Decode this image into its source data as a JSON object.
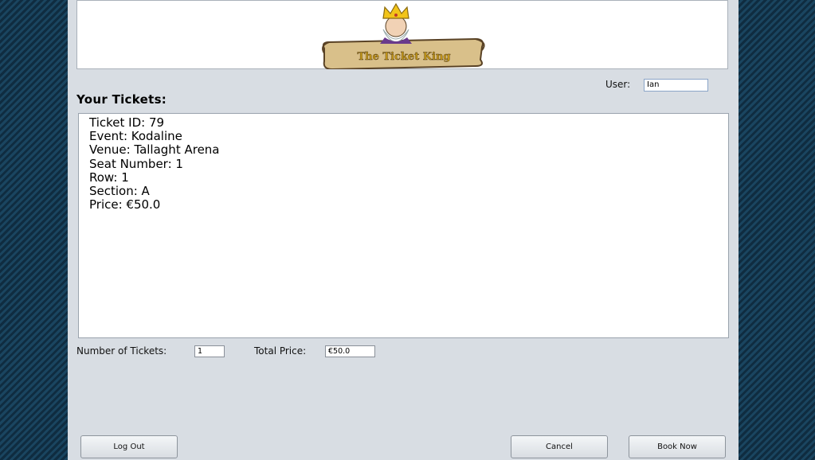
{
  "header": {
    "logo_text": "The Ticket King"
  },
  "user": {
    "label": "User:",
    "value": "Ian"
  },
  "tickets": {
    "title": "Your Tickets:",
    "lines": [
      "Ticket ID: 79",
      "Event: Kodaline",
      "Venue: Tallaght Arena",
      "Seat Number: 1",
      "Row: 1",
      "Section: A",
      "Price: €50.0"
    ]
  },
  "summary": {
    "num_tickets_label": "Number of Tickets:",
    "num_tickets_value": "1",
    "total_price_label": "Total Price:",
    "total_price_value": "€50.0"
  },
  "buttons": {
    "logout": "Log Out",
    "cancel": "Cancel",
    "book": "Book Now"
  }
}
